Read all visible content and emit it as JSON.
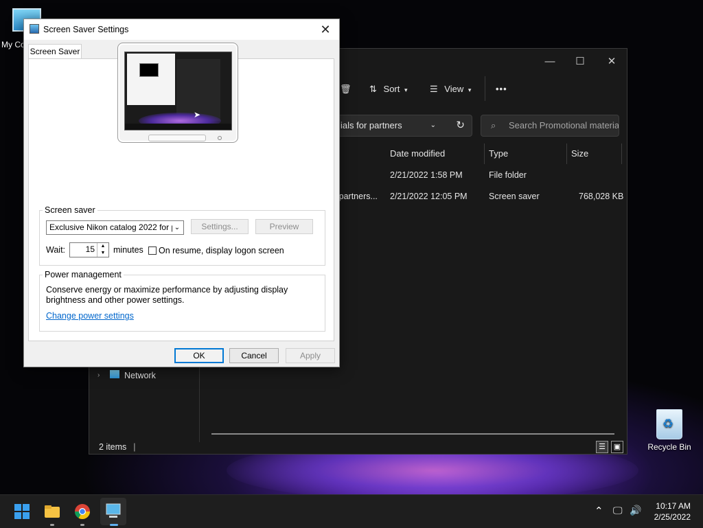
{
  "desktop": {
    "my_computer_label": "My Co",
    "recycle_bin_label": "Recycle Bin"
  },
  "explorer": {
    "toolbar": {
      "sort_label": "Sort",
      "view_label": "View",
      "more_label": "•••"
    },
    "address_text": "ials for partners",
    "search_placeholder": "Search Promotional material...",
    "columns": [
      "Date modified",
      "Type",
      "Size"
    ],
    "rows": [
      {
        "name": "",
        "date": "2/21/2022 1:58 PM",
        "type": "File folder",
        "size": ""
      },
      {
        "name": "r partners...",
        "date": "2/21/2022 12:05 PM",
        "type": "Screen saver",
        "size": "768,028 KB"
      }
    ],
    "nav_network": "Network",
    "status_items": "2 items"
  },
  "dialog": {
    "title": "Screen Saver Settings",
    "tab_label": "Screen Saver",
    "screen_saver_group": "Screen saver",
    "selected_saver": "Exclusive Nikon catalog 2022 for p",
    "settings_btn": "Settings...",
    "preview_btn": "Preview",
    "wait_label": "Wait:",
    "wait_value": "15",
    "minutes_label": "minutes",
    "resume_label": "On resume, display logon screen",
    "power_group": "Power management",
    "power_text_1": "Conserve energy or maximize performance by adjusting display",
    "power_text_2": "brightness and other power settings.",
    "power_link": "Change power settings",
    "ok_btn": "OK",
    "cancel_btn": "Cancel",
    "apply_btn": "Apply"
  },
  "taskbar": {
    "time": "10:17 AM",
    "date": "2/25/2022"
  }
}
